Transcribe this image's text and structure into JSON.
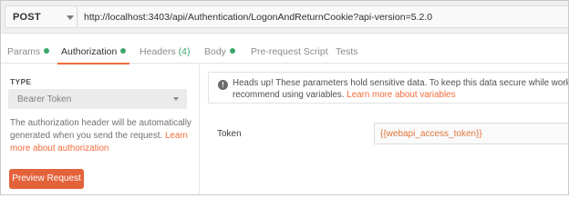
{
  "request": {
    "method": "POST",
    "url": "http://localhost:3403/api/Authentication/LogonAndReturnCookie?api-version=5.2.0"
  },
  "tabs": [
    {
      "label": "Params",
      "dot": true,
      "active": false
    },
    {
      "label": "Authorization",
      "dot": true,
      "active": true
    },
    {
      "label": "Headers",
      "count": "(4)",
      "active": false
    },
    {
      "label": "Body",
      "dot": true,
      "active": false
    },
    {
      "label": "Pre-request Script",
      "active": false
    },
    {
      "label": "Tests",
      "active": false
    }
  ],
  "auth": {
    "type_label": "TYPE",
    "selected_type": "Bearer Token",
    "help_text": "The authorization header will be automatically generated when you send the request.",
    "help_link": "Learn more about authorization",
    "preview_button": "Preview Request"
  },
  "warning": {
    "line1": "Heads up! These parameters hold sensitive data. To keep this data secure while working in a c",
    "line2": "recommend using variables.",
    "link": "Learn more about variables"
  },
  "token": {
    "label": "Token",
    "value": "{{webapi_access_token}}"
  },
  "colors": {
    "accent": "#f26b3a",
    "status_dot": "#3ea66b",
    "variable_text": "#e0743b"
  }
}
